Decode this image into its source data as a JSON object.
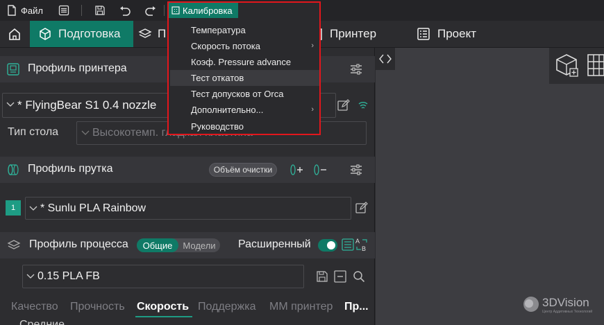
{
  "titlebar": {
    "file_label": "Файл",
    "calibration_label": "Калибровка"
  },
  "tabs": {
    "prepare": "Подготовка",
    "preview_partial": "П",
    "printer": "Принтер",
    "project": "Проект"
  },
  "printer_profile": {
    "title": "Профиль принтера",
    "selected": "* FlyingBear S1 0.4 nozzle",
    "bed_label": "Тип стола",
    "bed_value": "Высокотемп. гладкая пластина"
  },
  "filament_profile": {
    "title": "Профиль прутка",
    "purge_volume_label": "Объём очистки",
    "slot_number": "1",
    "selected": "* Sunlu PLA Rainbow"
  },
  "process_profile": {
    "title": "Профиль процесса",
    "toggle_global": "Общие",
    "toggle_models": "Модели",
    "advanced_label": "Расширенный",
    "advanced_on": true,
    "selected": "0.15 PLA FB"
  },
  "process_tabs": [
    "Качество",
    "Прочность",
    "Скорость",
    "Поддержка",
    "MM принтер",
    "Пр..."
  ],
  "process_tab_active": "Скорость",
  "bottom_partial_text": "Средние",
  "calibration_menu": {
    "items": [
      {
        "label": "Температура",
        "submenu": false
      },
      {
        "label": "Скорость потока",
        "submenu": true
      },
      {
        "label": "Коэф. Pressure advance",
        "submenu": false
      },
      {
        "label": "Тест откатов",
        "submenu": false,
        "highlighted": true
      },
      {
        "label": "Тест допусков от Orca",
        "submenu": false
      },
      {
        "label": "Дополнительно...",
        "submenu": true
      },
      {
        "label": "Руководство",
        "submenu": false
      }
    ]
  },
  "watermark": {
    "brand": "3DVision",
    "tagline": "Центр Аддитивных Технологий"
  },
  "colors": {
    "accent": "#0f7a66",
    "highlight_border": "#e3161c",
    "panel_bg": "#2d2d30"
  },
  "icons": [
    "file-icon",
    "menu-icon",
    "save-icon",
    "undo-icon",
    "redo-icon",
    "calibration-icon",
    "home-icon",
    "cube-icon",
    "layers-icon",
    "printer-icon",
    "project-icon",
    "printer-profile-icon",
    "settings-icon",
    "edit-icon",
    "wifi-icon",
    "filament-icon",
    "add-filament-icon",
    "remove-filament-icon",
    "process-icon",
    "compare-icon",
    "search-icon",
    "collapse-icon",
    "add-object-icon",
    "grid-icon"
  ]
}
